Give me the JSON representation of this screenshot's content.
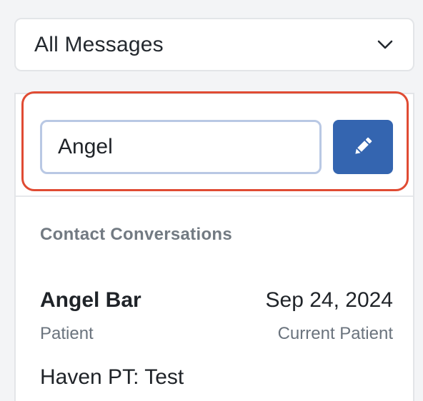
{
  "filter": {
    "selected": "All Messages",
    "icon": "chevron-down-icon"
  },
  "search": {
    "value": "Angel",
    "edit_icon": "pencil-icon",
    "highlight_color": "#e04b33",
    "button_color": "#3465b0"
  },
  "results": {
    "section_title": "Contact Conversations",
    "conversations": [
      {
        "name": "Angel Bar",
        "date": "Sep 24, 2024",
        "type": "Patient",
        "status": "Current Patient",
        "preview": "Haven PT: Test"
      }
    ]
  }
}
